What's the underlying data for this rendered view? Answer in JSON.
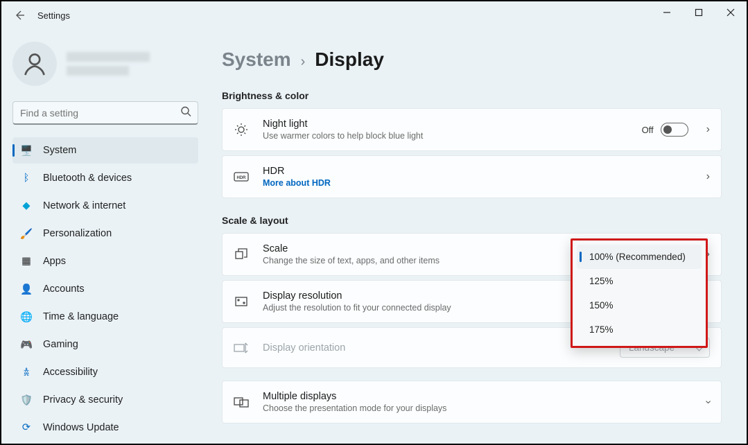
{
  "window": {
    "title": "Settings"
  },
  "search": {
    "placeholder": "Find a setting"
  },
  "breadcrumb": {
    "parent": "System",
    "current": "Display"
  },
  "sidebar": {
    "items": [
      {
        "label": "System"
      },
      {
        "label": "Bluetooth & devices"
      },
      {
        "label": "Network & internet"
      },
      {
        "label": "Personalization"
      },
      {
        "label": "Apps"
      },
      {
        "label": "Accounts"
      },
      {
        "label": "Time & language"
      },
      {
        "label": "Gaming"
      },
      {
        "label": "Accessibility"
      },
      {
        "label": "Privacy & security"
      },
      {
        "label": "Windows Update"
      }
    ]
  },
  "sections": {
    "brightness": "Brightness & color",
    "scale": "Scale & layout"
  },
  "nightlight": {
    "title": "Night light",
    "desc": "Use warmer colors to help block blue light",
    "state": "Off"
  },
  "hdr": {
    "title": "HDR",
    "link": "More about HDR"
  },
  "scaleCard": {
    "title": "Scale",
    "desc": "Change the size of text, apps, and other items",
    "options": [
      "100% (Recommended)",
      "125%",
      "150%",
      "175%"
    ]
  },
  "resolution": {
    "title": "Display resolution",
    "desc": "Adjust the resolution to fit your connected display"
  },
  "orientation": {
    "title": "Display orientation",
    "value": "Landscape"
  },
  "multiple": {
    "title": "Multiple displays",
    "desc": "Choose the presentation mode for your displays"
  }
}
